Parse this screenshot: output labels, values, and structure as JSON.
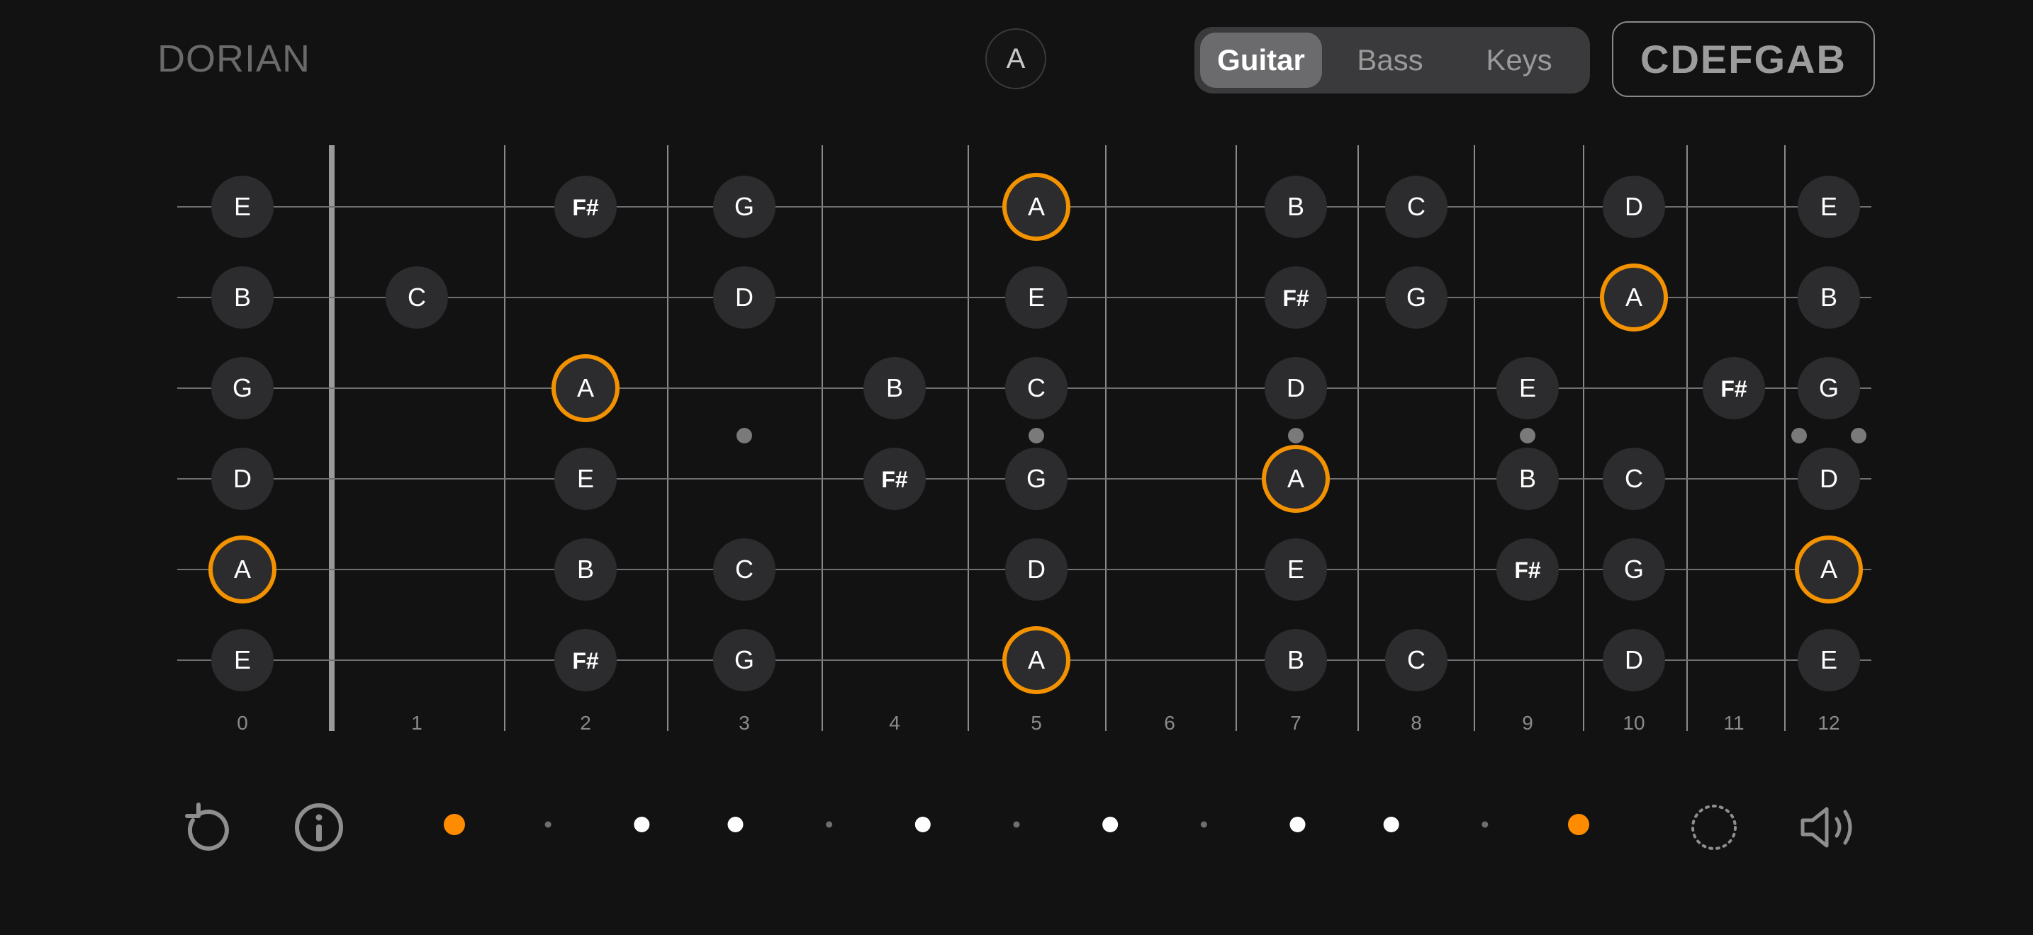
{
  "header": {
    "mode_label": "DORIAN",
    "root_note": "A",
    "instruments": [
      "Guitar",
      "Bass",
      "Keys"
    ],
    "selected_instrument": "Guitar",
    "notes_label": "CDEFGAB"
  },
  "fretboard": {
    "fret_numbers": [
      "0",
      "1",
      "2",
      "3",
      "4",
      "5",
      "6",
      "7",
      "8",
      "9",
      "10",
      "11",
      "12"
    ],
    "root": "A",
    "strings": [
      {
        "name": "high-e",
        "notes": [
          {
            "fret": 0,
            "note": "E"
          },
          {
            "fret": 2,
            "note": "F#"
          },
          {
            "fret": 3,
            "note": "G"
          },
          {
            "fret": 5,
            "note": "A"
          },
          {
            "fret": 7,
            "note": "B"
          },
          {
            "fret": 8,
            "note": "C"
          },
          {
            "fret": 10,
            "note": "D"
          },
          {
            "fret": 12,
            "note": "E"
          }
        ]
      },
      {
        "name": "b",
        "notes": [
          {
            "fret": 0,
            "note": "B"
          },
          {
            "fret": 1,
            "note": "C"
          },
          {
            "fret": 3,
            "note": "D"
          },
          {
            "fret": 5,
            "note": "E"
          },
          {
            "fret": 7,
            "note": "F#"
          },
          {
            "fret": 8,
            "note": "G"
          },
          {
            "fret": 10,
            "note": "A"
          },
          {
            "fret": 12,
            "note": "B"
          }
        ]
      },
      {
        "name": "g",
        "notes": [
          {
            "fret": 0,
            "note": "G"
          },
          {
            "fret": 2,
            "note": "A"
          },
          {
            "fret": 4,
            "note": "B"
          },
          {
            "fret": 5,
            "note": "C"
          },
          {
            "fret": 7,
            "note": "D"
          },
          {
            "fret": 9,
            "note": "E"
          },
          {
            "fret": 11,
            "note": "F#"
          },
          {
            "fret": 12,
            "note": "G"
          }
        ]
      },
      {
        "name": "d",
        "notes": [
          {
            "fret": 0,
            "note": "D"
          },
          {
            "fret": 2,
            "note": "E"
          },
          {
            "fret": 4,
            "note": "F#"
          },
          {
            "fret": 5,
            "note": "G"
          },
          {
            "fret": 7,
            "note": "A"
          },
          {
            "fret": 9,
            "note": "B"
          },
          {
            "fret": 10,
            "note": "C"
          },
          {
            "fret": 12,
            "note": "D"
          }
        ]
      },
      {
        "name": "a",
        "notes": [
          {
            "fret": 0,
            "note": "A"
          },
          {
            "fret": 2,
            "note": "B"
          },
          {
            "fret": 3,
            "note": "C"
          },
          {
            "fret": 5,
            "note": "D"
          },
          {
            "fret": 7,
            "note": "E"
          },
          {
            "fret": 9,
            "note": "F#"
          },
          {
            "fret": 10,
            "note": "G"
          },
          {
            "fret": 12,
            "note": "A"
          }
        ]
      },
      {
        "name": "low-e",
        "notes": [
          {
            "fret": 0,
            "note": "E"
          },
          {
            "fret": 2,
            "note": "F#"
          },
          {
            "fret": 3,
            "note": "G"
          },
          {
            "fret": 5,
            "note": "A"
          },
          {
            "fret": 7,
            "note": "B"
          },
          {
            "fret": 8,
            "note": "C"
          },
          {
            "fret": 10,
            "note": "D"
          },
          {
            "fret": 12,
            "note": "E"
          }
        ]
      }
    ],
    "inlay_frets": [
      3,
      5,
      7,
      9
    ],
    "double_inlay_fret": 12
  },
  "scale_indicator": {
    "steps": [
      "root",
      "small",
      "large",
      "large",
      "small",
      "large",
      "small",
      "large",
      "small",
      "large",
      "large",
      "small",
      "root"
    ]
  },
  "controls": {
    "reset_icon": "reset-arrow-icon",
    "info_icon": "info-icon",
    "loading_icon": "dotted-circle-icon",
    "sound_icon": "speaker-icon"
  },
  "colors": {
    "background": "#121212",
    "note_fill": "#2c2c2e",
    "root_ring": "#f39200",
    "string": "#6f6f6f",
    "fret": "#8a8a8a",
    "accent": "#ff8c00"
  }
}
